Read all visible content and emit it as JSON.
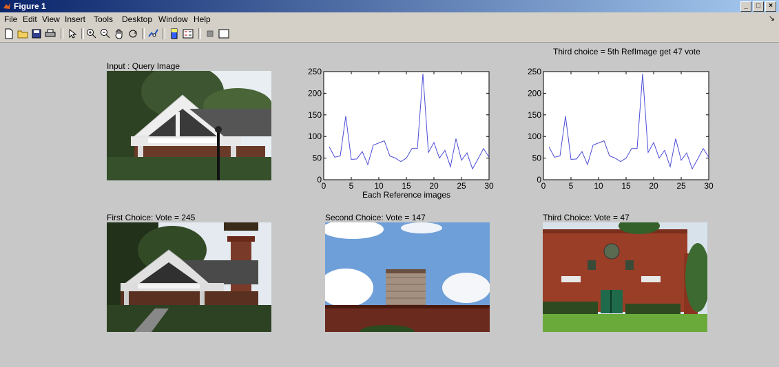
{
  "window": {
    "title": "Figure 1",
    "buttons": [
      "_",
      "□",
      "×"
    ]
  },
  "menu": [
    "File",
    "Edit",
    "View",
    "Insert",
    "Tools",
    "Desktop",
    "Window",
    "Help"
  ],
  "toolbar": {
    "icons": [
      "new-file-icon",
      "open-folder-icon",
      "save-icon",
      "print-icon",
      "pointer-icon",
      "zoom-in-icon",
      "zoom-out-icon",
      "pan-hand-icon",
      "rotate-3d-icon",
      "data-cursor-icon",
      "colorbar-icon",
      "legend-icon",
      "hide-plot-tools-icon",
      "show-plot-tools-icon"
    ]
  },
  "figure": {
    "top_title": "Third choice = 5th RefImage get 47 vote",
    "labels": {
      "query": "Input : Query Image",
      "first": "First Choice: Vote = 245",
      "second": "Second Choice: Vote = 147",
      "third": "Third Choice: Vote = 47"
    }
  },
  "chart_data": [
    {
      "type": "line",
      "xlabel": "Each Reference images",
      "ylabel": "",
      "xlim": [
        0,
        30
      ],
      "ylim": [
        0,
        250
      ],
      "xticks": [
        0,
        5,
        10,
        15,
        20,
        25,
        30
      ],
      "yticks": [
        0,
        50,
        100,
        150,
        200,
        250
      ],
      "color": "#4b4bd6",
      "series": [
        {
          "x": [
            1,
            2,
            3,
            4,
            5,
            6,
            7,
            8,
            9,
            10,
            11,
            12,
            13,
            14,
            15,
            16,
            17,
            18,
            19,
            20,
            21,
            22,
            23,
            24,
            25,
            26,
            27,
            28,
            29,
            30
          ],
          "values": [
            76,
            52,
            55,
            147,
            47,
            48,
            65,
            35,
            80,
            85,
            90,
            55,
            50,
            42,
            50,
            72,
            72,
            245,
            63,
            86,
            50,
            68,
            30,
            95,
            45,
            62,
            25,
            48,
            72,
            52
          ]
        }
      ]
    },
    {
      "type": "line",
      "xlabel": "",
      "ylabel": "",
      "xlim": [
        0,
        30
      ],
      "ylim": [
        0,
        250
      ],
      "xticks": [
        0,
        5,
        10,
        15,
        20,
        25,
        30
      ],
      "yticks": [
        0,
        50,
        100,
        150,
        200,
        250
      ],
      "color": "#4b4bd6",
      "series": [
        {
          "x": [
            1,
            2,
            3,
            4,
            5,
            6,
            7,
            8,
            9,
            10,
            11,
            12,
            13,
            14,
            15,
            16,
            17,
            18,
            19,
            20,
            21,
            22,
            23,
            24,
            25,
            26,
            27,
            28,
            29,
            30
          ],
          "values": [
            76,
            52,
            55,
            147,
            47,
            48,
            65,
            35,
            80,
            85,
            90,
            55,
            50,
            42,
            50,
            72,
            72,
            245,
            63,
            86,
            50,
            68,
            30,
            95,
            45,
            62,
            25,
            48,
            72,
            52
          ]
        }
      ]
    }
  ]
}
